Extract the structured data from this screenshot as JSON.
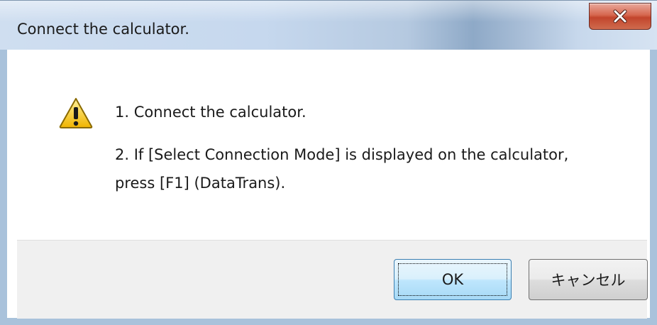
{
  "window": {
    "title": "Connect the calculator.",
    "close_icon": "close-icon"
  },
  "message": {
    "icon": "warning-icon",
    "line1": "1. Connect the calculator.",
    "line2": "2. If [Select Connection Mode] is displayed on the calculator,",
    "line3": "press [F1] (DataTrans)."
  },
  "buttons": {
    "ok_label": "OK",
    "cancel_label": "キャンセル"
  },
  "colors": {
    "close_button": "#c2452c",
    "warning_yellow": "#f5c400",
    "footer_bg": "#f0f0f0",
    "default_button_border": "#3c7fb1"
  }
}
